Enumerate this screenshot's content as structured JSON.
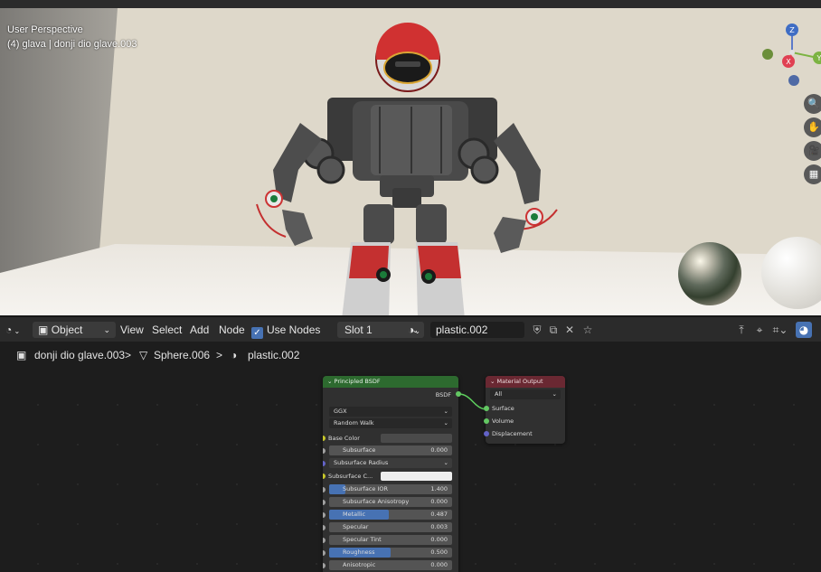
{
  "viewport": {
    "perspective_label": "User Perspective",
    "object_label": "(4) glava | donji dio glave.003",
    "gizmo": {
      "z": "Z",
      "x": "X",
      "y": "Y"
    },
    "tool_icons": [
      "zoom-icon",
      "hand-icon",
      "camera-icon",
      "grid-icon"
    ]
  },
  "header": {
    "editor_type_icon": "shader-editor-icon",
    "mode": "Object",
    "menus": [
      "View",
      "Select",
      "Add",
      "Node"
    ],
    "use_nodes_label": "Use Nodes",
    "use_nodes_checked": true,
    "slot": "Slot 1",
    "material_name": "plastic.002"
  },
  "breadcrumb": {
    "object": "donji dio glave.003",
    "mesh": "Sphere.006",
    "material": "plastic.002",
    "separator": ">"
  },
  "principled_bsdf": {
    "title": "Principled BSDF",
    "output_label": "BSDF",
    "distribution": "GGX",
    "subsurface_method": "Random Walk",
    "base_color_label": "Base Color",
    "subsurface_color_label": "Subsurface C...",
    "subsurface_radius_label": "Subsurface Radius",
    "fields": [
      {
        "label": "Subsurface",
        "value": "0.000",
        "fill": 0.0
      },
      {
        "label": "Subsurface IOR",
        "value": "1.400",
        "fill": 0.0
      },
      {
        "label": "Subsurface Anisotropy",
        "value": "0.000",
        "fill": 0.0
      },
      {
        "label": "Metallic",
        "value": "0.487",
        "fill": 0.487
      },
      {
        "label": "Specular",
        "value": "0.003",
        "fill": 0.003
      },
      {
        "label": "Specular Tint",
        "value": "0.000",
        "fill": 0.0
      },
      {
        "label": "Roughness",
        "value": "0.500",
        "fill": 0.5
      },
      {
        "label": "Anisotropic",
        "value": "0.000",
        "fill": 0.0
      }
    ]
  },
  "material_output": {
    "title": "Material Output",
    "target": "All",
    "inputs": [
      "Surface",
      "Volume",
      "Displacement"
    ]
  }
}
